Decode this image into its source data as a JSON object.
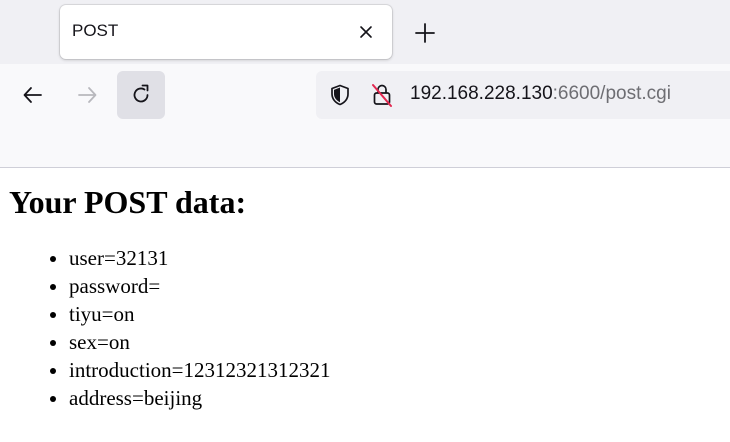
{
  "tab": {
    "title": "POST"
  },
  "urlbar": {
    "host": "192.168.228.130",
    "rest": ":6600/post.cgi"
  },
  "icons": {
    "tab_close": "close-icon",
    "new_tab": "plus-icon",
    "back": "arrow-left-icon",
    "forward": "arrow-right-icon",
    "reload": "reload-icon",
    "tracking_protection": "shield-icon",
    "insecure_connection": "lock-strikethrough-icon"
  },
  "colors": {
    "insecure_accent": "#e22850"
  },
  "page": {
    "heading": "Your POST data:",
    "items": [
      "user=32131",
      "password=",
      "tiyu=on",
      "sex=on",
      "introduction=12312321312321",
      "address=beijing"
    ]
  }
}
